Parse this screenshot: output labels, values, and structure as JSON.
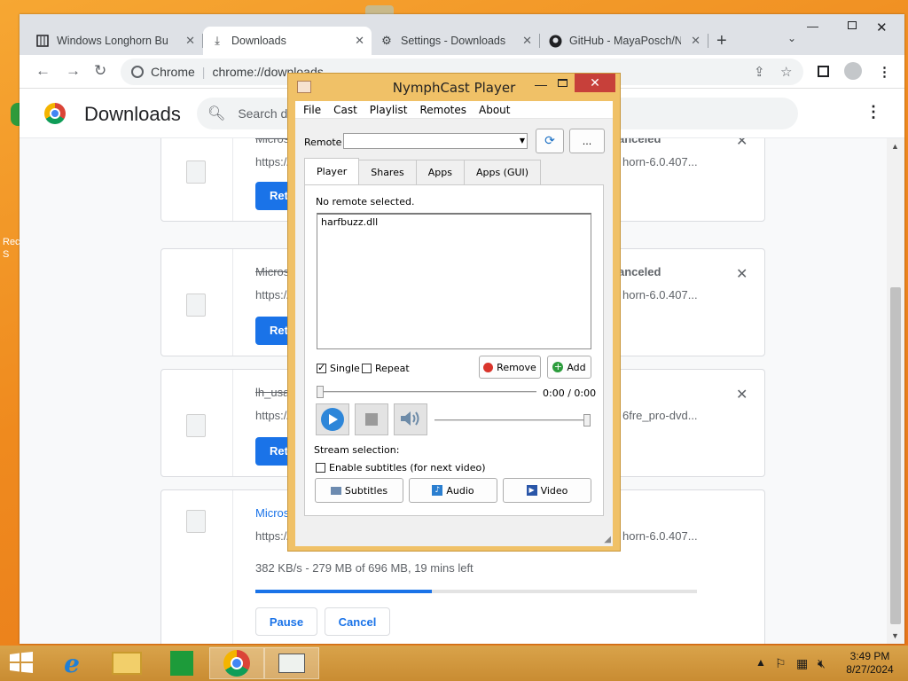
{
  "desktop": {
    "icon_label": "Rec\nS"
  },
  "chrome": {
    "tabs": [
      {
        "label": "Windows Longhorn Bui",
        "icon": "page-icon"
      },
      {
        "label": "Downloads",
        "icon": "download-icon"
      },
      {
        "label": "Settings - Downloads",
        "icon": "gear-icon"
      },
      {
        "label": "GitHub - MayaPosch/N",
        "icon": "github-icon"
      }
    ],
    "omnibox": {
      "site": "Chrome",
      "url": "chrome://downloads"
    },
    "page_title": "Downloads",
    "search_placeholder": "Search downloads"
  },
  "downloads": [
    {
      "name": "Micros",
      "url_left": "https://",
      "url_right": "horn-6.0.407...",
      "status": "anceled",
      "button": "Retr"
    },
    {
      "name": "Micros",
      "url_left": "https://",
      "url_right": "horn-6.0.407...",
      "status": "anceled",
      "button": "Retr"
    },
    {
      "name": "lh_usa",
      "url_left": "https://",
      "url_right": "6fre_pro-dvd...",
      "status": "",
      "button": "Retr"
    },
    {
      "name": "Micros",
      "url_left": "https://",
      "url_right": "horn-6.0.407...",
      "progress_text": "382 KB/s - 279 MB of 696 MB, 19 mins left",
      "progress": 0.4,
      "pause": "Pause",
      "cancel": "Cancel"
    }
  ],
  "nymphcast": {
    "title": "NymphCast Player",
    "menu": [
      "File",
      "Cast",
      "Playlist",
      "Remotes",
      "About"
    ],
    "remote_label": "Remote",
    "remote_value": "",
    "more_label": "...",
    "tabs": [
      "Player",
      "Shares",
      "Apps",
      "Apps (GUI)"
    ],
    "status": "No remote selected.",
    "playlist": [
      "harfbuzz.dll"
    ],
    "single_label": "Single",
    "single_checked": true,
    "repeat_label": "Repeat",
    "repeat_checked": false,
    "remove_label": "Remove",
    "add_label": "Add",
    "time": "0:00 / 0:00",
    "position": 0,
    "volume": 1.0,
    "stream_label": "Stream selection:",
    "subtitles_checkbox_label": "Enable subtitles (for next video)",
    "subtitles_button": "Subtitles",
    "audio_button": "Audio",
    "video_button": "Video"
  },
  "taskbar": {
    "time": "3:49 PM",
    "date": "8/27/2024"
  }
}
